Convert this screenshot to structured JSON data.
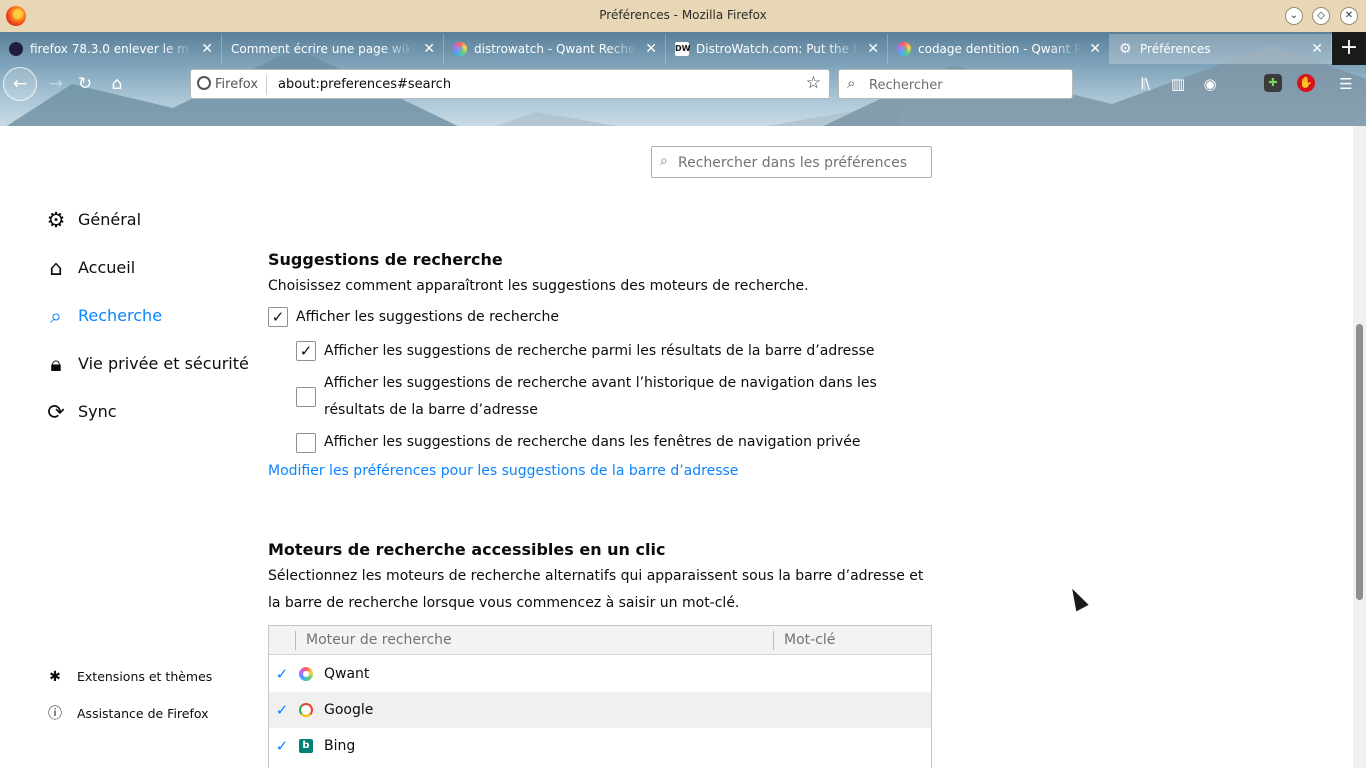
{
  "window": {
    "title": "Préférences - Mozilla Firefox",
    "controls": [
      "minimize",
      "maximize",
      "close"
    ]
  },
  "tabs": [
    {
      "title": "firefox 78.3.0 enlever le m",
      "favicon": "firefox-news-icon",
      "active": false
    },
    {
      "title": "Comment écrire une page wiki -",
      "favicon": "document-icon",
      "active": false
    },
    {
      "title": "distrowatch - Qwant Reche",
      "favicon": "qwant-icon",
      "active": false
    },
    {
      "title": "DistroWatch.com: Put the f",
      "favicon": "distrowatch-icon",
      "active": false
    },
    {
      "title": "codage dentition - Qwant R",
      "favicon": "qwant-icon",
      "active": false
    },
    {
      "title": "Préférences",
      "favicon": "gear-icon",
      "active": true
    }
  ],
  "toolbar": {
    "identity_label": "Firefox",
    "url": "about:preferences#search",
    "search_placeholder": "Rechercher"
  },
  "preferences_search": {
    "placeholder": "Rechercher dans les préférences"
  },
  "sidebar": {
    "categories": [
      {
        "label": "Général",
        "icon": "gear-icon",
        "selected": false
      },
      {
        "label": "Accueil",
        "icon": "home-icon",
        "selected": false
      },
      {
        "label": "Recherche",
        "icon": "search-icon",
        "selected": true
      },
      {
        "label": "Vie privée et sécurité",
        "icon": "lock-icon",
        "selected": false
      },
      {
        "label": "Sync",
        "icon": "sync-icon",
        "selected": false
      }
    ],
    "footer": [
      {
        "label": "Extensions et thèmes",
        "icon": "puzzle-icon"
      },
      {
        "label": "Assistance de Firefox",
        "icon": "help-icon"
      }
    ]
  },
  "suggestions": {
    "heading": "Suggestions de recherche",
    "description": "Choisissez comment apparaîtront les suggestions des moteurs de recherche.",
    "show_suggestions": {
      "label": "Afficher les suggestions de recherche",
      "checked": true
    },
    "options": [
      {
        "label": "Afficher les suggestions de recherche parmi les résultats de la barre d’adresse",
        "checked": true
      },
      {
        "label": "Afficher les suggestions de recherche avant l’historique de navigation dans les résultats de la barre d’adresse",
        "checked": false
      },
      {
        "label": "Afficher les suggestions de recherche dans les fenêtres de navigation privée",
        "checked": false
      }
    ],
    "link": "Modifier les préférences pour les suggestions de la barre d’adresse"
  },
  "one_click": {
    "heading": "Moteurs de recherche accessibles en un clic",
    "description": "Sélectionnez les moteurs de recherche alternatifs qui apparaissent sous la barre d’adresse et la barre de recherche lorsque vous commencez à saisir un mot-clé.",
    "columns": {
      "engine": "Moteur de recherche",
      "keyword": "Mot-clé"
    },
    "engines": [
      {
        "name": "Qwant",
        "enabled": true,
        "keyword": ""
      },
      {
        "name": "Google",
        "enabled": true,
        "keyword": ""
      },
      {
        "name": "Bing",
        "enabled": true,
        "keyword": ""
      }
    ]
  },
  "colors": {
    "accent": "#0a84ff",
    "titlebar": "#e8d7b5"
  }
}
